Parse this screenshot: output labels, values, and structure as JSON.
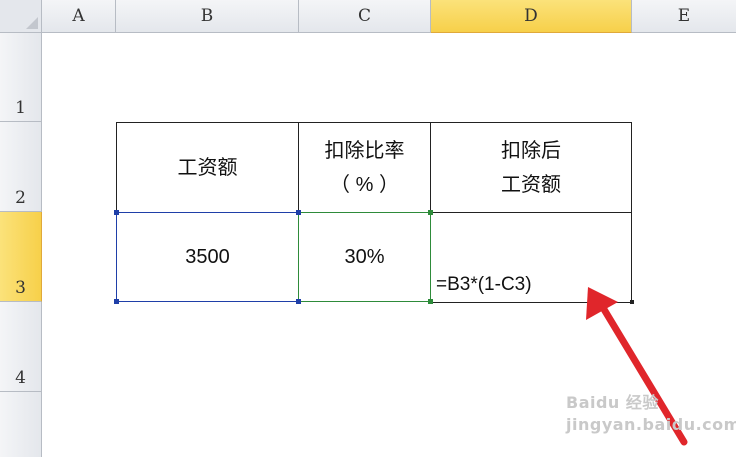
{
  "columns": [
    "A",
    "B",
    "C",
    "D",
    "E"
  ],
  "rows": [
    "1",
    "2",
    "3",
    "4"
  ],
  "table": {
    "header": {
      "b": "工资额",
      "c_line1": "扣除比率",
      "c_line2": "（ % ）",
      "d_line1": "扣除后",
      "d_line2": "工资额"
    },
    "row3": {
      "b": "3500",
      "c": "30%",
      "d_formula": "=B3*(1-C3)"
    }
  },
  "active_cell": {
    "column": "D",
    "row": "3"
  },
  "colors": {
    "active_header": "#f7d04a",
    "arrow": "#e0262b",
    "reference_b3": "#1f3fa8",
    "reference_c3": "#2e8b3a"
  },
  "watermark": "Baidu 经验 jingyan.baidu.com"
}
